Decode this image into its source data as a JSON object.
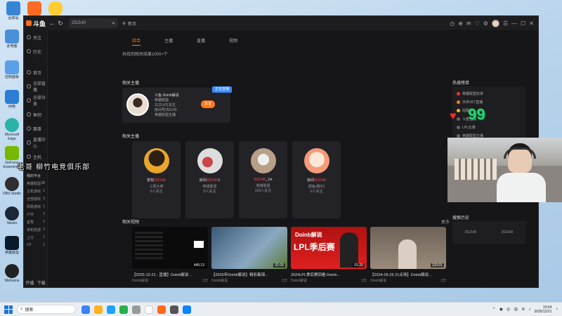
{
  "desktop": {
    "icons": [
      {
        "label": "回收站",
        "color": "#3a84d6"
      },
      {
        "label": "此电脑",
        "color": "#4a90d9"
      },
      {
        "label": "控制面板",
        "color": "#5aa0e8"
      },
      {
        "label": "网络",
        "color": "#2a7fd4"
      },
      {
        "label": "Microsoft Edge",
        "color": "#2bb3a8"
      },
      {
        "label": "GeForce Experience",
        "color": "#76b900"
      },
      {
        "label": "OBS Studio",
        "color": "#302e31"
      },
      {
        "label": "Steam",
        "color": "#1b2838"
      },
      {
        "label": "英雄联盟",
        "color": "#0a1a2a"
      },
      {
        "label": "WeGame",
        "color": "#222"
      }
    ],
    "top_icons": [
      {
        "label": "",
        "color": "#ff6b22"
      },
      {
        "label": "",
        "color": "#ffcc33"
      }
    ]
  },
  "window": {
    "logo": "斗鱼",
    "back": "←",
    "refresh": "↻",
    "tab_title": "252140",
    "tab_close": "✕",
    "new_tab": "新页",
    "right_icons": [
      "◷",
      "⊕",
      "✉",
      "♡",
      "⚙",
      "☰",
      "—",
      "☐",
      "✕"
    ]
  },
  "sidebar": {
    "items": [
      {
        "label": "关注"
      },
      {
        "label": "历史"
      },
      {
        "label": "首页"
      },
      {
        "label": "全部直播"
      },
      {
        "label": "全部分类"
      },
      {
        "label": "鱼吧"
      },
      {
        "label": "赛事"
      },
      {
        "label": "直播中心"
      },
      {
        "label": "主机"
      }
    ],
    "sub_header": "我的平台",
    "subs": [
      {
        "left": "英雄联盟",
        "right": "28"
      },
      {
        "left": "主机游戏",
        "right": "1"
      },
      {
        "label2": "",
        "left": "全部游戏",
        "right": "3"
      },
      {
        "left": "网易游戏",
        "right": "1"
      },
      {
        "left": "户外",
        "right": "2"
      },
      {
        "left": "星秀",
        "right": "1"
      },
      {
        "left": "单机热游",
        "right": "2"
      },
      {
        "left": "上分",
        "right": "1"
      },
      {
        "left": "CF",
        "right": "1"
      }
    ],
    "bottom": [
      "开播",
      "下载"
    ]
  },
  "main": {
    "tabs": [
      "综合",
      "主播",
      "直播",
      "视频"
    ],
    "active_tab": "综合",
    "count_text": "共找到相关结果1000+个",
    "related_anchor": "相关主播",
    "main_card": {
      "name": "斗鱼·Doinb解说",
      "l2": "英雄联盟",
      "l3": "1123.4万关注",
      "l4": "房间号252140",
      "l5": "英雄联盟主播",
      "follow": "关注",
      "badge": "正在直播"
    },
    "more_anchors_title": "相关主播",
    "anchors": [
      {
        "name_a": "复刻",
        "name_hl": "252140",
        "sub": "三周大佬",
        "fans": "0人关注",
        "color": "#e8a62a"
      },
      {
        "name_a": "房间",
        "name_hl": "252140",
        "name_b": "1",
        "sub": "英雄联盟",
        "fans": "0人关注",
        "color": "#c44"
      },
      {
        "name_a": "",
        "name_hl": "252140",
        "name_b": "_1st",
        "sub": "英雄联盟",
        "fans": "229人关注",
        "color": "#b8a088"
      },
      {
        "name_a": "房间",
        "name_hl": "252140",
        "name_b": "",
        "sub": "摸鱼(偶尔)",
        "fans": "0人关注",
        "color": "#f59a7a"
      }
    ],
    "videos_title": "相关视频",
    "more": "更多",
    "videos": [
      {
        "title": "【2025-12-21 · 直播】Doinb解说...",
        "author": "Doinb解说",
        "plays": "1万",
        "dur": "445:13",
        "bg": "#0b0b0b"
      },
      {
        "title": "【2025年Doinb解说】精彩集锦...",
        "author": "Doinb解说",
        "plays": "1万",
        "dur": "01:05",
        "bg": "#4a6a88"
      },
      {
        "title": "2024LPL季后赛回看 Doinb...",
        "author": "Doinb解说",
        "plays": "1万",
        "dur": "01:20",
        "bg": "#d81e1e",
        "overlay1": "Doinb解说",
        "overlay2": "LPL季后赛"
      },
      {
        "title": "【2024-05-26 21点场】Doinb解说...",
        "author": "Doinb解说",
        "plays": "1万",
        "dur": "120:01",
        "bg": "#7a6a60"
      }
    ],
    "right_panel": {
      "title": "热搜榜单",
      "items": [
        {
          "label": "英雄联盟玩家",
          "color": "#e33"
        },
        {
          "label": "天命1KT直播",
          "color": "#ff7a1a"
        },
        {
          "label": "陆服",
          "color": "#ffb21a"
        },
        {
          "label": "斗鱼主播",
          "color": "#666"
        },
        {
          "label": "LPL比赛",
          "color": "#666"
        },
        {
          "label": "英雄联盟主播",
          "color": "#666"
        }
      ]
    },
    "history": {
      "title": "搜索历史",
      "items": [
        "252140",
        "252140"
      ]
    }
  },
  "overlay": {
    "heart": "♥",
    "count": "99",
    "club_text": "老哥 柳竹电竞俱乐部"
  },
  "taskbar": {
    "search_placeholder": "搜索",
    "apps": [
      "#3b82f6",
      "#ffb21a",
      "#1aa3ff",
      "#22b14c",
      "#999",
      "#e8e8e8",
      "#ff6a1a",
      "#555",
      "#0a84ff"
    ],
    "tray_text": "中",
    "time": "19:04",
    "date": "2025/12/21"
  }
}
